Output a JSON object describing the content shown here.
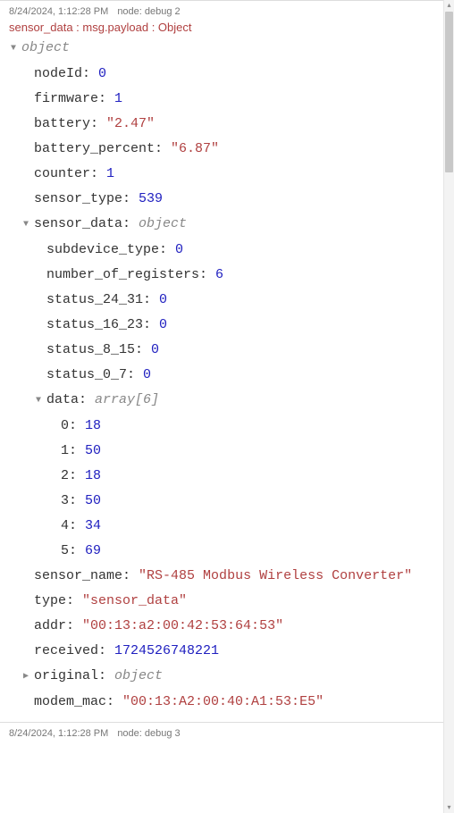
{
  "entry1": {
    "timestamp": "8/24/2024, 1:12:28 PM",
    "node": "node: debug 2",
    "path": "sensor_data : msg.payload : Object",
    "root_type": "object",
    "nodeId": "0",
    "firmware": "1",
    "battery": "\"2.47\"",
    "battery_percent": "\"6.87\"",
    "counter": "1",
    "sensor_type": "539",
    "sensor_data_type": "object",
    "subdevice_type": "0",
    "number_of_registers": "6",
    "status_24_31": "0",
    "status_16_23": "0",
    "status_8_15": "0",
    "status_0_7": "0",
    "data_type": "array[6]",
    "d0": "18",
    "d1": "50",
    "d2": "18",
    "d3": "50",
    "d4": "34",
    "d5": "69",
    "sensor_name": "\"RS-485 Modbus Wireless Converter\"",
    "type": "\"sensor_data\"",
    "addr": "\"00:13:a2:00:42:53:64:53\"",
    "received": "1724526748221",
    "original_type": "object",
    "modem_mac": "\"00:13:A2:00:40:A1:53:E5\""
  },
  "entry2": {
    "timestamp": "8/24/2024, 1:12:28 PM",
    "node": "node: debug 3"
  }
}
